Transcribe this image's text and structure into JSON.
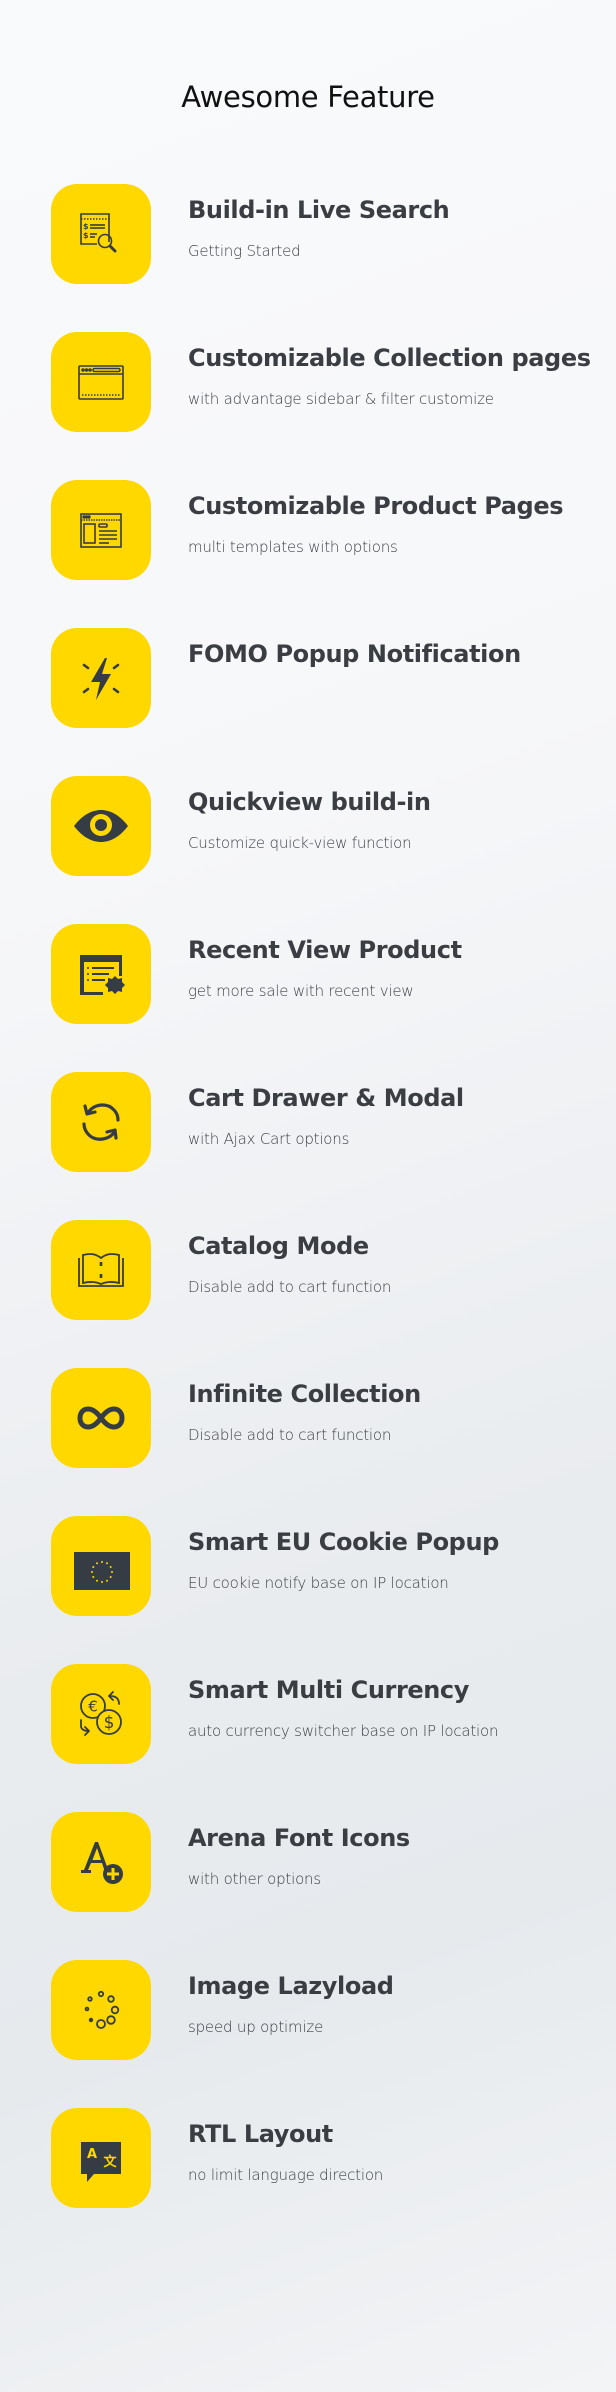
{
  "header": {
    "title": "Awesome Feature"
  },
  "colors": {
    "icon_bg": "#ffd800",
    "icon_fg": "#363c44",
    "title_text": "#3a3d42"
  },
  "features": [
    {
      "icon": "search-invoice-icon",
      "title": "Build-in Live Search",
      "desc": "Getting Started"
    },
    {
      "icon": "browser-window-icon",
      "title": "Customizable Collection pages",
      "desc": "with advantage sidebar & filter customize"
    },
    {
      "icon": "page-layout-icon",
      "title": "Customizable Product Pages",
      "desc": "multi templates with options"
    },
    {
      "icon": "lightning-icon",
      "title": "FOMO Popup Notification",
      "desc": ""
    },
    {
      "icon": "eye-icon",
      "title": "Quickview build-in",
      "desc": "Customize quick-view function"
    },
    {
      "icon": "recent-list-badge-icon",
      "title": "Recent View Product",
      "desc": "get more sale with recent view"
    },
    {
      "icon": "refresh-icon",
      "title": "Cart Drawer & Modal",
      "desc": "with Ajax Cart options"
    },
    {
      "icon": "open-book-icon",
      "title": "Catalog Mode",
      "desc": "Disable add to cart function"
    },
    {
      "icon": "infinity-icon",
      "title": "Infinite Collection",
      "desc": "Disable add to cart function"
    },
    {
      "icon": "eu-flag-icon",
      "title": "Smart EU Cookie Popup",
      "desc": "EU cookie notify base on IP location"
    },
    {
      "icon": "currency-exchange-icon",
      "title": "Smart Multi Currency",
      "desc": "auto currency switcher base on IP location"
    },
    {
      "icon": "font-add-icon",
      "title": "Arena Font Icons",
      "desc": "with other options"
    },
    {
      "icon": "loading-spinner-icon",
      "title": "Image Lazyload",
      "desc": "speed up optimize"
    },
    {
      "icon": "translate-icon",
      "title": "RTL Layout",
      "desc": "no limit language direction"
    }
  ]
}
